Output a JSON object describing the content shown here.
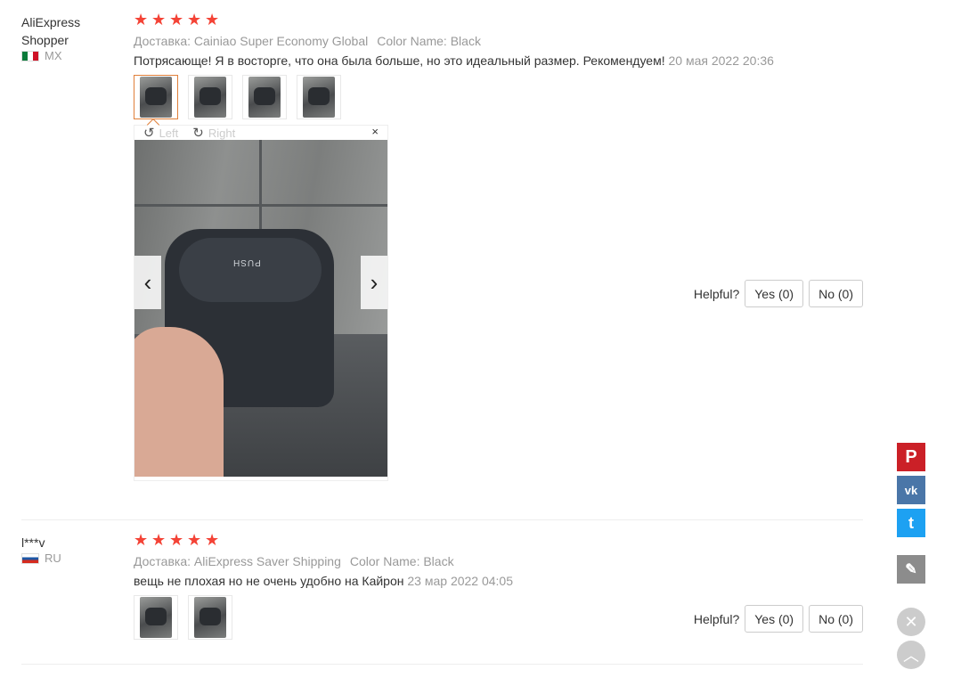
{
  "reviews": [
    {
      "user": "AliExpress Shopper",
      "country": "MX",
      "rating": 5,
      "shipping": "Доставка: Cainiao Super Economy Global",
      "color": "Color Name: Black",
      "text": "Потрясающе! Я в восторге, что она была больше, но это идеальный размер. Рекомендуем!",
      "date": "20 мая 2022 20:36",
      "photo_count": 4,
      "viewer": {
        "left_label": "Left",
        "right_label": "Right",
        "close_label": "×",
        "photo_text": "PUSH"
      },
      "helpful_label": "Helpful?",
      "yes_label": "Yes (0)",
      "no_label": "No (0)"
    },
    {
      "user": "l***v",
      "country": "RU",
      "rating": 5,
      "shipping": "Доставка: AliExpress Saver Shipping",
      "color": "Color Name: Black",
      "text": "вещь не плохая но не очень удобно на Кайрон",
      "date": "23 мар 2022 04:05",
      "photo_count": 2,
      "helpful_label": "Helpful?",
      "yes_label": "Yes (0)",
      "no_label": "No (0)"
    }
  ],
  "share": {
    "pinterest_icon": "P",
    "vk_icon": "vk",
    "twitter_icon": "t",
    "edit_icon": "✎",
    "close_icon": "✕",
    "up_icon": "︿"
  },
  "colors": {
    "star": "#f44336",
    "active_thumb": "#e07f3a",
    "pinterest": "#cb2027",
    "vk": "#4a76a8",
    "twitter": "#1da1f2"
  }
}
